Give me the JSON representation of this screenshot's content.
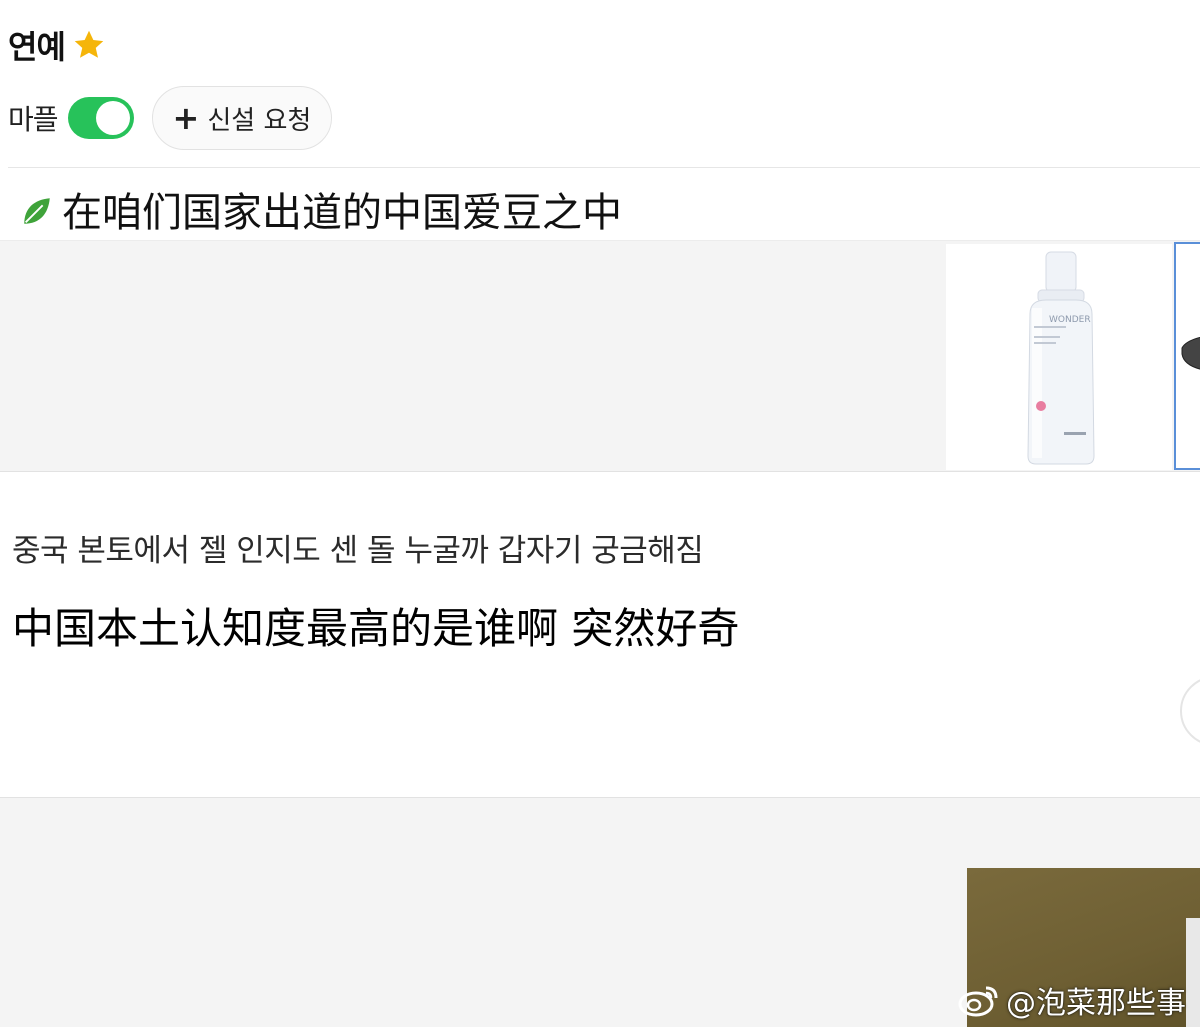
{
  "header": {
    "category_title": "연예",
    "star_color": "#f5b50a"
  },
  "controls": {
    "mapl_label": "마플",
    "toggle_on": true,
    "toggle_color": "#27c25a",
    "new_board_label": "신설 요청",
    "new_board_icon": "plus-icon"
  },
  "banner": {
    "icon": "leaf-icon",
    "text": "在咱们国家出道的中国爱豆之中"
  },
  "ad_product": {
    "bottle_brand": "WONDER"
  },
  "post": {
    "korean_text": "중국 본토에서 젤 인지도 센 돌 누굴까 갑자기 궁금해짐",
    "chinese_text": "中国本土认知度最高的是谁啊  突然好奇"
  },
  "watermark": {
    "icon": "weibo-icon",
    "text": "@泡菜那些事"
  }
}
